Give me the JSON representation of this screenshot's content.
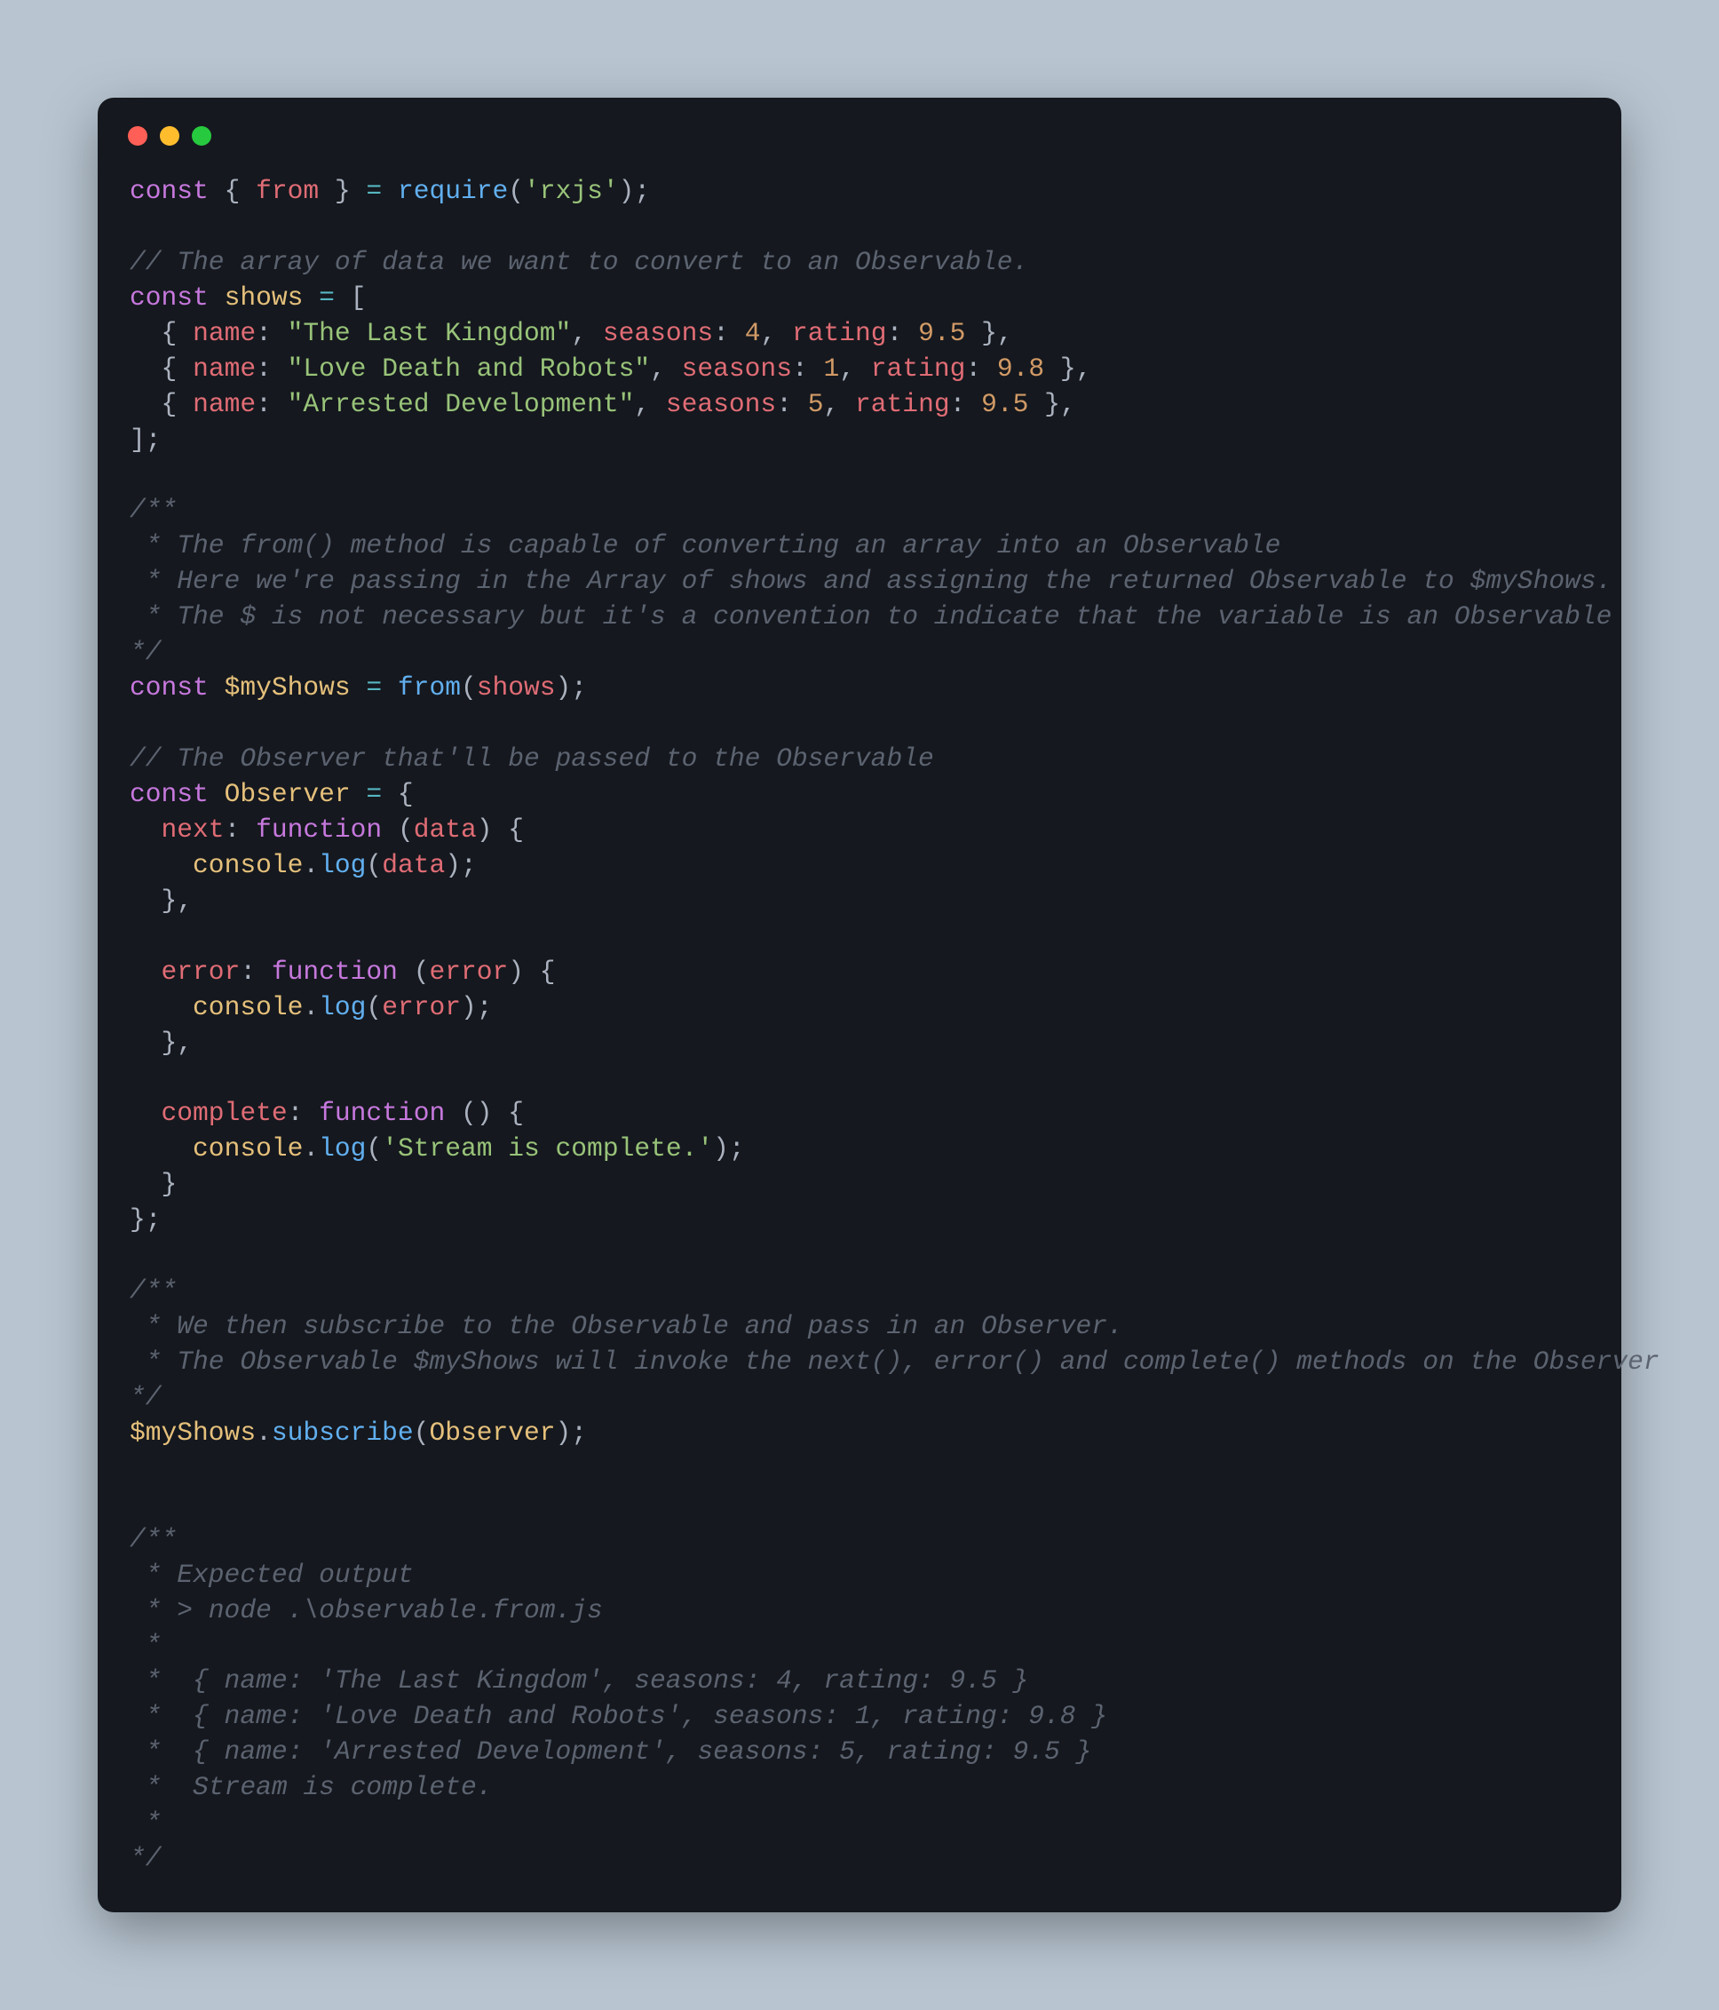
{
  "traffic": {
    "red": "close",
    "yellow": "minimize",
    "green": "zoom"
  },
  "l1": {
    "const": "const",
    "sp": " ",
    "ob": "{ ",
    "from": "from",
    "cb": " }",
    "eq": " = ",
    "req": "require",
    "op": "(",
    "str": "'rxjs'",
    "cp": ");"
  },
  "blank": "",
  "c1": "// The array of data we want to convert to an Observable.",
  "l3": {
    "const": "const",
    "sp": " ",
    "shows": "shows",
    "eq": " = ",
    "br": "["
  },
  "row": {
    "ind": "  ",
    "ob": "{ ",
    "nameK": "name",
    "col": ": ",
    "com": ", ",
    "seasonsK": "seasons",
    "ratingK": "rating",
    "cb": " }",
    "comE": ",",
    "n1": "\"The Last Kingdom\"",
    "s1": "4",
    "r1": "9.5",
    "n2": "\"Love Death and Robots\"",
    "s2": "1",
    "r2": "9.8",
    "n3": "\"Arrested Development\"",
    "s3": "5",
    "r3": "9.5"
  },
  "l7": "];",
  "cb1a": "/**",
  "cb1b": " * The from() method is capable of converting an array into an Observable",
  "cb1c": " * Here we're passing in the Array of shows and assigning the returned Observable to $myShows.",
  "cb1d": " * The $ is not necessary but it's a convention to indicate that the variable is an Observable",
  "cb1e": "*/",
  "l9": {
    "const": "const",
    "sp": " ",
    "my": "$myShows",
    "eq": " = ",
    "from": "from",
    "op": "(",
    "shows": "shows",
    "cp": ");"
  },
  "c2": "// The Observer that'll be passed to the Observable",
  "l11": {
    "const": "const",
    "sp": " ",
    "obs": "Observer",
    "eq": " = ",
    "ob": "{"
  },
  "m": {
    "ind": "  ",
    "ind2": "    ",
    "next": "next",
    "error": "error",
    "complete": "complete",
    "col": ": ",
    "fn": "function",
    "sp": " ",
    "op": "(",
    "cp": ")",
    "opb": " {",
    "data": "data",
    "err": "error",
    "console": "console",
    "dot": ".",
    "log": "log",
    "semi": ";",
    "cbr": "}",
    "com": ",",
    "streamStr": "'Stream is complete.'",
    "closeObs": "};"
  },
  "cb2a": "/**",
  "cb2b": " * We then subscribe to the Observable and pass in an Observer.",
  "cb2c": " * The Observable $myShows will invoke the next(), error() and complete() methods on the Observer",
  "cb2d": "*/",
  "sub": {
    "my": "$myShows",
    "dot": ".",
    "fn": "subscribe",
    "op": "(",
    "obs": "Observer",
    "cp": ");"
  },
  "cb3a": "/**",
  "cb3b": " * Expected output",
  "cb3c": " * > node .\\observable.from.js",
  "cb3d": " *",
  "cb3e": " *  { name: 'The Last Kingdom', seasons: 4, rating: 9.5 }",
  "cb3f": " *  { name: 'Love Death and Robots', seasons: 1, rating: 9.8 }",
  "cb3g": " *  { name: 'Arrested Development', seasons: 5, rating: 9.5 }",
  "cb3h": " *  Stream is complete.",
  "cb3i": " *",
  "cb3j": "*/"
}
